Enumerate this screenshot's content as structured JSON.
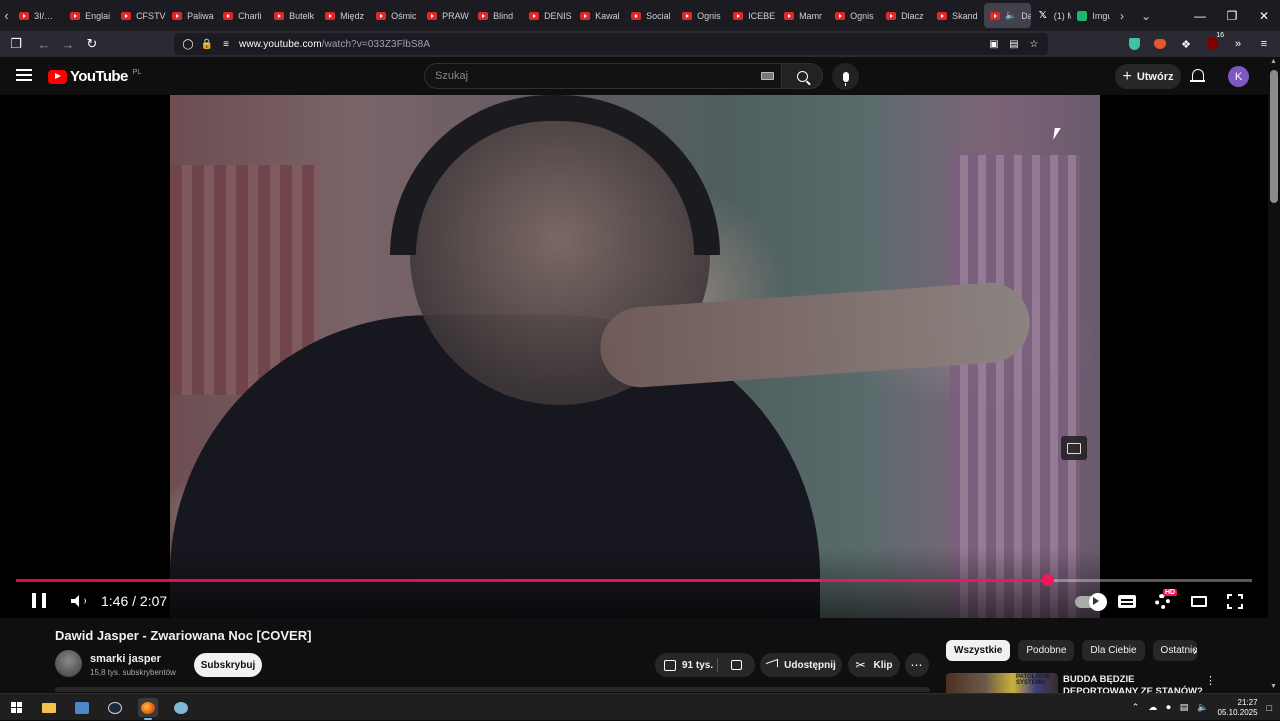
{
  "browser": {
    "tabs": [
      {
        "label": "3I/…",
        "favicon": "youtube"
      },
      {
        "label": "Englai",
        "favicon": "youtube"
      },
      {
        "label": "CFSTV",
        "favicon": "youtube"
      },
      {
        "label": "Paliwa",
        "favicon": "youtube"
      },
      {
        "label": "Charli",
        "favicon": "youtube"
      },
      {
        "label": "Butelk",
        "favicon": "youtube"
      },
      {
        "label": "Międz",
        "favicon": "youtube"
      },
      {
        "label": "Ośmic",
        "favicon": "youtube"
      },
      {
        "label": "PRAW",
        "favicon": "youtube"
      },
      {
        "label": "Blind",
        "favicon": "youtube"
      },
      {
        "label": "DENIS",
        "favicon": "youtube"
      },
      {
        "label": "Kawal",
        "favicon": "youtube"
      },
      {
        "label": "Social",
        "favicon": "youtube"
      },
      {
        "label": "Ognis",
        "favicon": "youtube"
      },
      {
        "label": "ICEBE",
        "favicon": "youtube"
      },
      {
        "label": "Mamr",
        "favicon": "youtube"
      },
      {
        "label": "Ognis",
        "favicon": "youtube"
      },
      {
        "label": "Dlacz",
        "favicon": "youtube"
      },
      {
        "label": "Skand",
        "favicon": "youtube"
      }
    ],
    "active_tab": {
      "label": "Dav",
      "favicon": "youtube"
    },
    "extra_tabs": [
      {
        "label": "(1) M",
        "favicon": "x"
      },
      {
        "label": "Imgur",
        "favicon": "imgur"
      }
    ],
    "url_host": "www.youtube.com",
    "url_path": "/watch?v=033Z3FlbS8A",
    "extension_badge": "16"
  },
  "youtube": {
    "logo_text": "YouTube",
    "region": "PL",
    "search_placeholder": "Szukaj",
    "create_label": "Utwórz",
    "avatar_letter": "K",
    "avatar_color": "#7e57c2",
    "accent_color": "#f0185a"
  },
  "player": {
    "current_time": "1:46",
    "duration": "2:07",
    "time_display": "1:46 / 2:07",
    "progress_fraction": 0.835,
    "hd_badge": "HD"
  },
  "video": {
    "title": "Dawid Jasper - Zwariowana Noc [COVER]",
    "channel_name": "smarki jasper",
    "subscribers": "15,8 tys. subskrybentów",
    "subscribe_label": "Subskrybuj",
    "likes": "91 tys.",
    "share_label": "Udostępnij",
    "clip_label": "Klip"
  },
  "recommendations": {
    "chips": [
      "Wszystkie",
      "Podobne",
      "Dla Ciebie",
      "Ostatnio"
    ],
    "first_title": "BUDDA BĘDZIE DEPORTOWANY ZE STANÓW? (ELON MUSK vs",
    "first_thumb_text": "PATOLOGIE SYSTEMU"
  },
  "taskbar": {
    "time": "21:27",
    "date": "05.10.2025"
  }
}
